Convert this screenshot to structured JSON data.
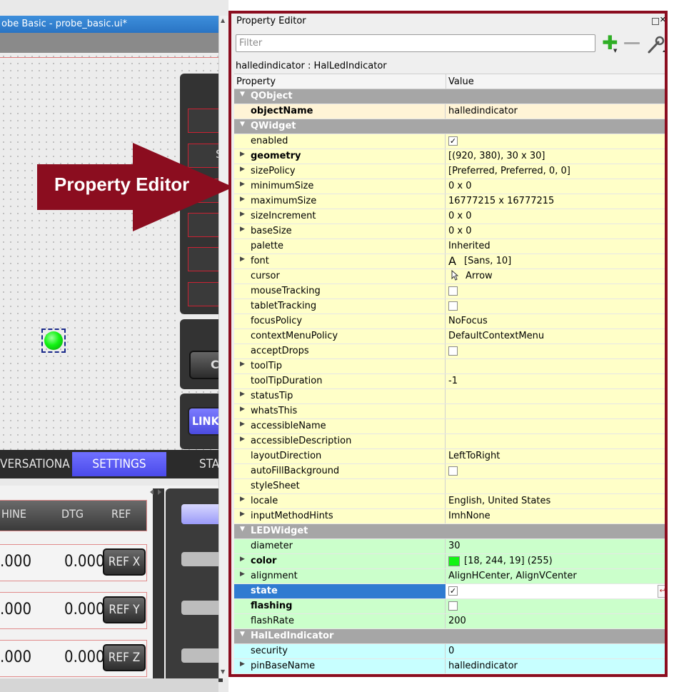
{
  "designer": {
    "window_title": "obe Basic - probe_basic.ui*",
    "cancel_fragment": "C",
    "link_fragment": "LINK A",
    "s_fragment": "S",
    "tabs": {
      "conversational": "VERSATIONAL",
      "settings": "SETTINGS",
      "status": "STAT"
    },
    "dro": {
      "headers": {
        "machine": "HINE",
        "dtg": "DTG",
        "ref": "REF"
      },
      "rows": [
        {
          "machine": ".000",
          "dtg": "0.000",
          "ref": "REF X"
        },
        {
          "machine": ".000",
          "dtg": "0.000",
          "ref": "REF Y"
        },
        {
          "machine": ".000",
          "dtg": "0.000",
          "ref": "REF Z"
        }
      ]
    },
    "led_color": "#12f413"
  },
  "callout": {
    "label": "Property Editor",
    "color": "#8b0d1f"
  },
  "property_editor": {
    "title": "Property Editor",
    "filter_placeholder": "Filter",
    "object_header": "halledindicator : HalLedIndicator",
    "columns": {
      "property": "Property",
      "value": "Value"
    },
    "rows": [
      {
        "kind": "group",
        "name": "QObject"
      },
      {
        "kind": "prop",
        "bg": "y2",
        "bold": true,
        "name": "objectName",
        "value": "halledindicator"
      },
      {
        "kind": "group",
        "name": "QWidget"
      },
      {
        "kind": "prop",
        "bg": "y",
        "name": "enabled",
        "check": true
      },
      {
        "kind": "prop",
        "bg": "y",
        "bold": true,
        "expand": true,
        "name": "geometry",
        "value": "[(920, 380), 30 x 30]"
      },
      {
        "kind": "prop",
        "bg": "y",
        "expand": true,
        "name": "sizePolicy",
        "value": "[Preferred, Preferred, 0, 0]"
      },
      {
        "kind": "prop",
        "bg": "y",
        "expand": true,
        "name": "minimumSize",
        "value": "0 x 0"
      },
      {
        "kind": "prop",
        "bg": "y",
        "expand": true,
        "name": "maximumSize",
        "value": "16777215 x 16777215"
      },
      {
        "kind": "prop",
        "bg": "y",
        "expand": true,
        "name": "sizeIncrement",
        "value": "0 x 0"
      },
      {
        "kind": "prop",
        "bg": "y",
        "expand": true,
        "name": "baseSize",
        "value": "0 x 0"
      },
      {
        "kind": "prop",
        "bg": "y",
        "name": "palette",
        "value": "Inherited"
      },
      {
        "kind": "prop",
        "bg": "y",
        "expand": true,
        "name": "font",
        "value": "[Sans, 10]",
        "icon": "font"
      },
      {
        "kind": "prop",
        "bg": "y",
        "name": "cursor",
        "value": "Arrow",
        "icon": "cursor"
      },
      {
        "kind": "prop",
        "bg": "y",
        "name": "mouseTracking",
        "check": false
      },
      {
        "kind": "prop",
        "bg": "y",
        "name": "tabletTracking",
        "check": false
      },
      {
        "kind": "prop",
        "bg": "y",
        "name": "focusPolicy",
        "value": "NoFocus"
      },
      {
        "kind": "prop",
        "bg": "y",
        "name": "contextMenuPolicy",
        "value": "DefaultContextMenu"
      },
      {
        "kind": "prop",
        "bg": "y",
        "name": "acceptDrops",
        "check": false
      },
      {
        "kind": "prop",
        "bg": "y",
        "expand": true,
        "name": "toolTip",
        "value": ""
      },
      {
        "kind": "prop",
        "bg": "y",
        "name": "toolTipDuration",
        "value": "-1"
      },
      {
        "kind": "prop",
        "bg": "y",
        "expand": true,
        "name": "statusTip",
        "value": ""
      },
      {
        "kind": "prop",
        "bg": "y",
        "expand": true,
        "name": "whatsThis",
        "value": ""
      },
      {
        "kind": "prop",
        "bg": "y",
        "expand": true,
        "name": "accessibleName",
        "value": ""
      },
      {
        "kind": "prop",
        "bg": "y",
        "expand": true,
        "name": "accessibleDescription",
        "value": ""
      },
      {
        "kind": "prop",
        "bg": "y",
        "name": "layoutDirection",
        "value": "LeftToRight"
      },
      {
        "kind": "prop",
        "bg": "y",
        "name": "autoFillBackground",
        "check": false
      },
      {
        "kind": "prop",
        "bg": "y",
        "name": "styleSheet",
        "value": ""
      },
      {
        "kind": "prop",
        "bg": "y",
        "expand": true,
        "name": "locale",
        "value": "English, United States"
      },
      {
        "kind": "prop",
        "bg": "y",
        "expand": true,
        "name": "inputMethodHints",
        "value": "ImhNone"
      },
      {
        "kind": "group",
        "name": "LEDWidget"
      },
      {
        "kind": "prop",
        "bg": "g",
        "name": "diameter",
        "value": "30"
      },
      {
        "kind": "prop",
        "bg": "g",
        "bold": true,
        "expand": true,
        "name": "color",
        "value": "[18, 244, 19] (255)",
        "icon": "swatch"
      },
      {
        "kind": "prop",
        "bg": "g",
        "expand": true,
        "name": "alignment",
        "value": "AlignHCenter, AlignVCenter"
      },
      {
        "kind": "prop",
        "bg": "sel",
        "bold": true,
        "name": "state",
        "check": true,
        "reset": true
      },
      {
        "kind": "prop",
        "bg": "g",
        "bold": true,
        "name": "flashing",
        "check": false
      },
      {
        "kind": "prop",
        "bg": "g",
        "name": "flashRate",
        "value": "200"
      },
      {
        "kind": "group",
        "name": "HalLedIndicator"
      },
      {
        "kind": "prop",
        "bg": "c",
        "name": "security",
        "value": "0"
      },
      {
        "kind": "prop",
        "bg": "c",
        "expand": true,
        "name": "pinBaseName",
        "value": "halledindicator"
      }
    ]
  }
}
